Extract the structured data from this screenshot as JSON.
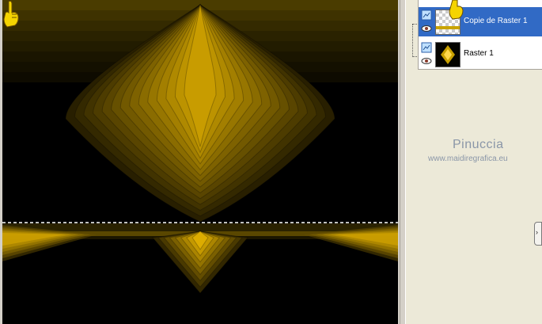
{
  "canvas": {
    "background": "#000000",
    "accent": "#ffd000"
  },
  "layers": [
    {
      "name": "Copie de Raster 1",
      "selected": true,
      "thumbnail": "checker-with-gold-strip"
    },
    {
      "name": "Raster 1",
      "selected": false,
      "thumbnail": "dark-with-gold-diamond"
    }
  ],
  "watermark": {
    "name": "Pinuccia",
    "url": "www.maidiregrafica.eu"
  },
  "icons": {
    "visibility": "eye-icon",
    "layer-type": "raster-layer-icon",
    "pointer": "pointing-hand-cursor",
    "scroll": "scroll-right-arrow-icon"
  },
  "colors": {
    "selection": "#316ac5",
    "panel": "#ece9d8",
    "gold": "#f5c400"
  },
  "scroll_arrow_glyph": "›"
}
